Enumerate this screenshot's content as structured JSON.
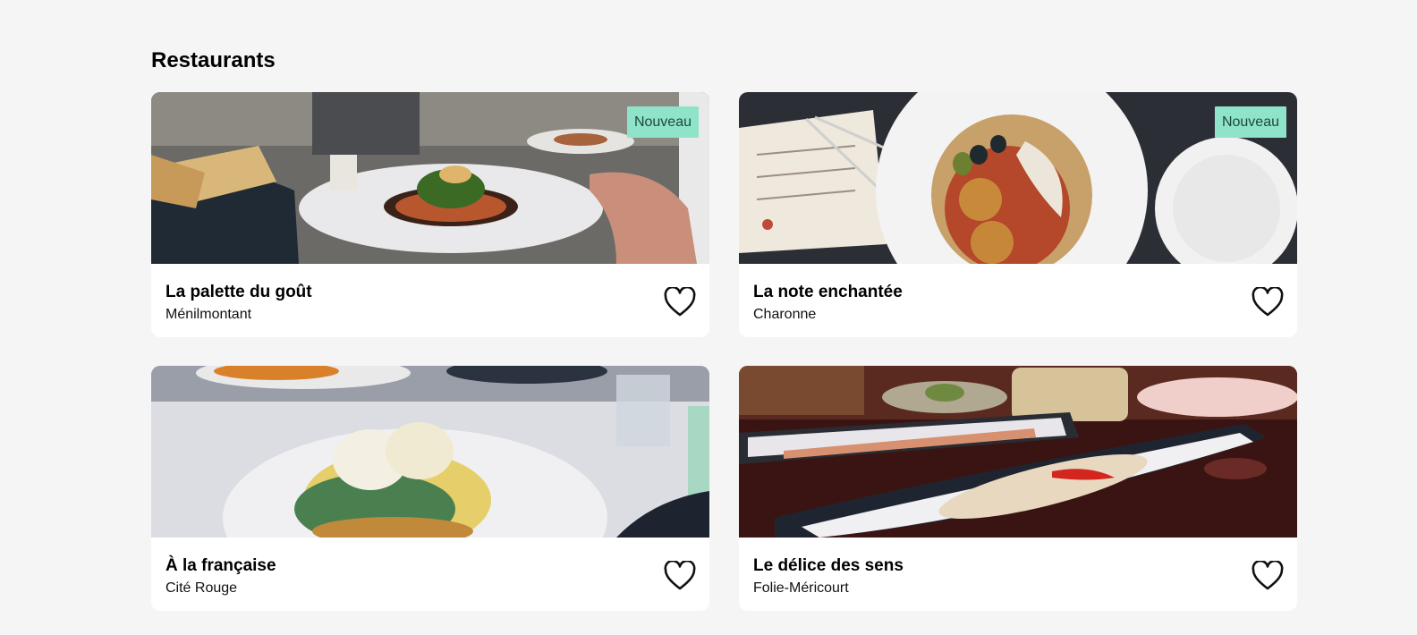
{
  "section": {
    "title": "Restaurants"
  },
  "restaurants": [
    {
      "name": "La palette du goût",
      "area": "Ménilmontant",
      "badge": "Nouveau",
      "photo": "plated dish with greens on a white plate, bread basket, glasses"
    },
    {
      "name": "La note enchantée",
      "area": "Charonne",
      "badge": "Nouveau",
      "photo": "white plate with croquettes, olives and squid, menu card and tongs"
    },
    {
      "name": "À la française",
      "area": "Cité Rouge",
      "badge": "",
      "photo": "eggs benedict on spinach on a white plate, glass of water"
    },
    {
      "name": "Le délice des sens",
      "area": "Folie-Méricourt",
      "badge": "",
      "photo": "long ceramic dishes with fish and red pepper on a dark table"
    }
  ],
  "icons": {
    "favorite": "heart-outline-icon"
  },
  "colors": {
    "background": "#f5f5f5",
    "card": "#ffffff",
    "badge_bg": "#8fe3c8",
    "badge_text": "#1a4a3c"
  }
}
